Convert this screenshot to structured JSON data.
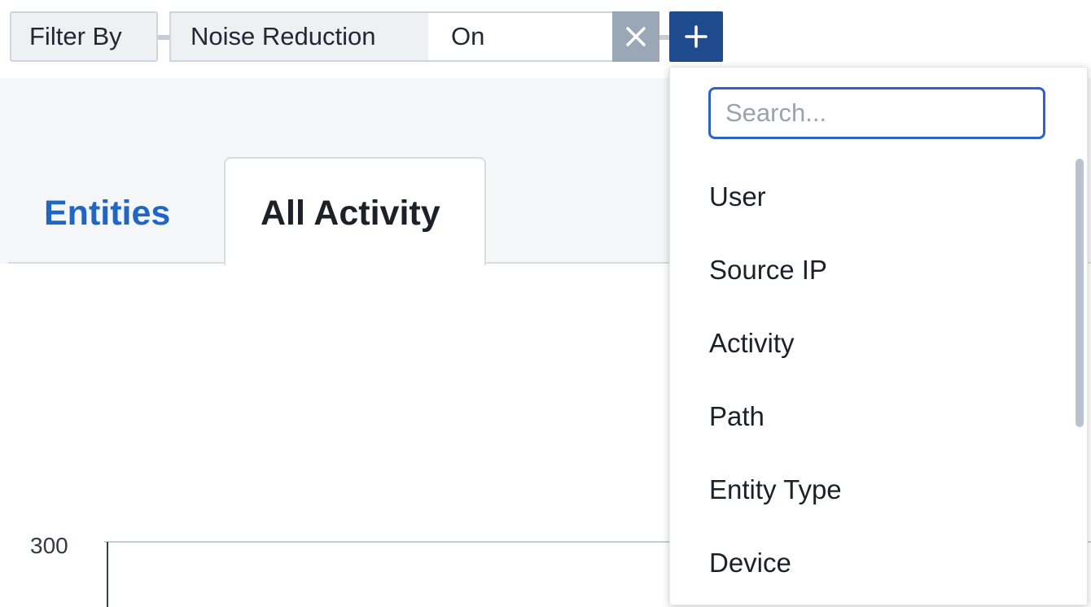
{
  "filter": {
    "label": "Filter By",
    "field": "Noise Reduction",
    "value": "On",
    "clear_icon": "close-icon",
    "add_icon": "plus-icon"
  },
  "tabs": [
    {
      "label": "Entities",
      "active": false
    },
    {
      "label": "All Activity",
      "active": true
    }
  ],
  "chart": {
    "y_tick": "300"
  },
  "dropdown": {
    "search_placeholder": "Search...",
    "items": [
      {
        "label": "User"
      },
      {
        "label": "Source IP"
      },
      {
        "label": "Activity"
      },
      {
        "label": "Path"
      },
      {
        "label": "Entity Type"
      },
      {
        "label": "Device"
      }
    ]
  },
  "colors": {
    "accent": "#1f4b8e",
    "link": "#2166c2",
    "focus": "#2b64c4"
  }
}
